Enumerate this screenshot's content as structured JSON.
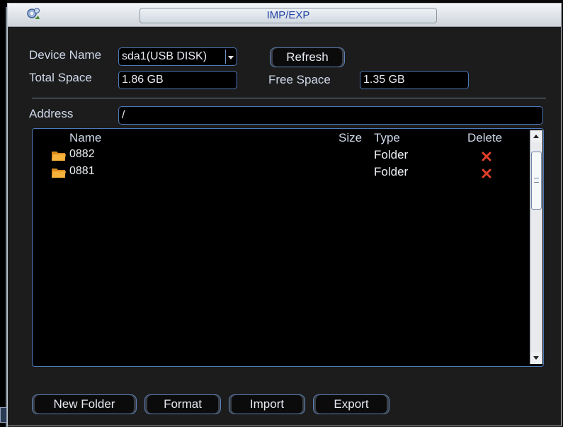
{
  "window": {
    "title": "IMP/EXP"
  },
  "device": {
    "name_label": "Device Name",
    "name_value": "sda1(USB DISK)",
    "refresh_label": "Refresh",
    "total_label": "Total Space",
    "total_value": "1.86 GB",
    "free_label": "Free Space",
    "free_value": "1.35 GB"
  },
  "address": {
    "label": "Address",
    "value": "/"
  },
  "list": {
    "columns": {
      "name": "Name",
      "size": "Size",
      "type": "Type",
      "delete": "Delete"
    },
    "rows": [
      {
        "name": "0882",
        "size": "",
        "type": "Folder",
        "icon": "folder-icon",
        "delete_icon": "delete-x-icon"
      },
      {
        "name": "0881",
        "size": "",
        "type": "Folder",
        "icon": "folder-icon",
        "delete_icon": "delete-x-icon"
      }
    ]
  },
  "buttons": {
    "new_folder": "New Folder",
    "format": "Format",
    "import": "Import",
    "export": "Export"
  },
  "colors": {
    "accent_border": "#4d79b8",
    "title_text": "#1f3fa2",
    "delete_red": "#e0402a",
    "folder": "#f2a531"
  }
}
